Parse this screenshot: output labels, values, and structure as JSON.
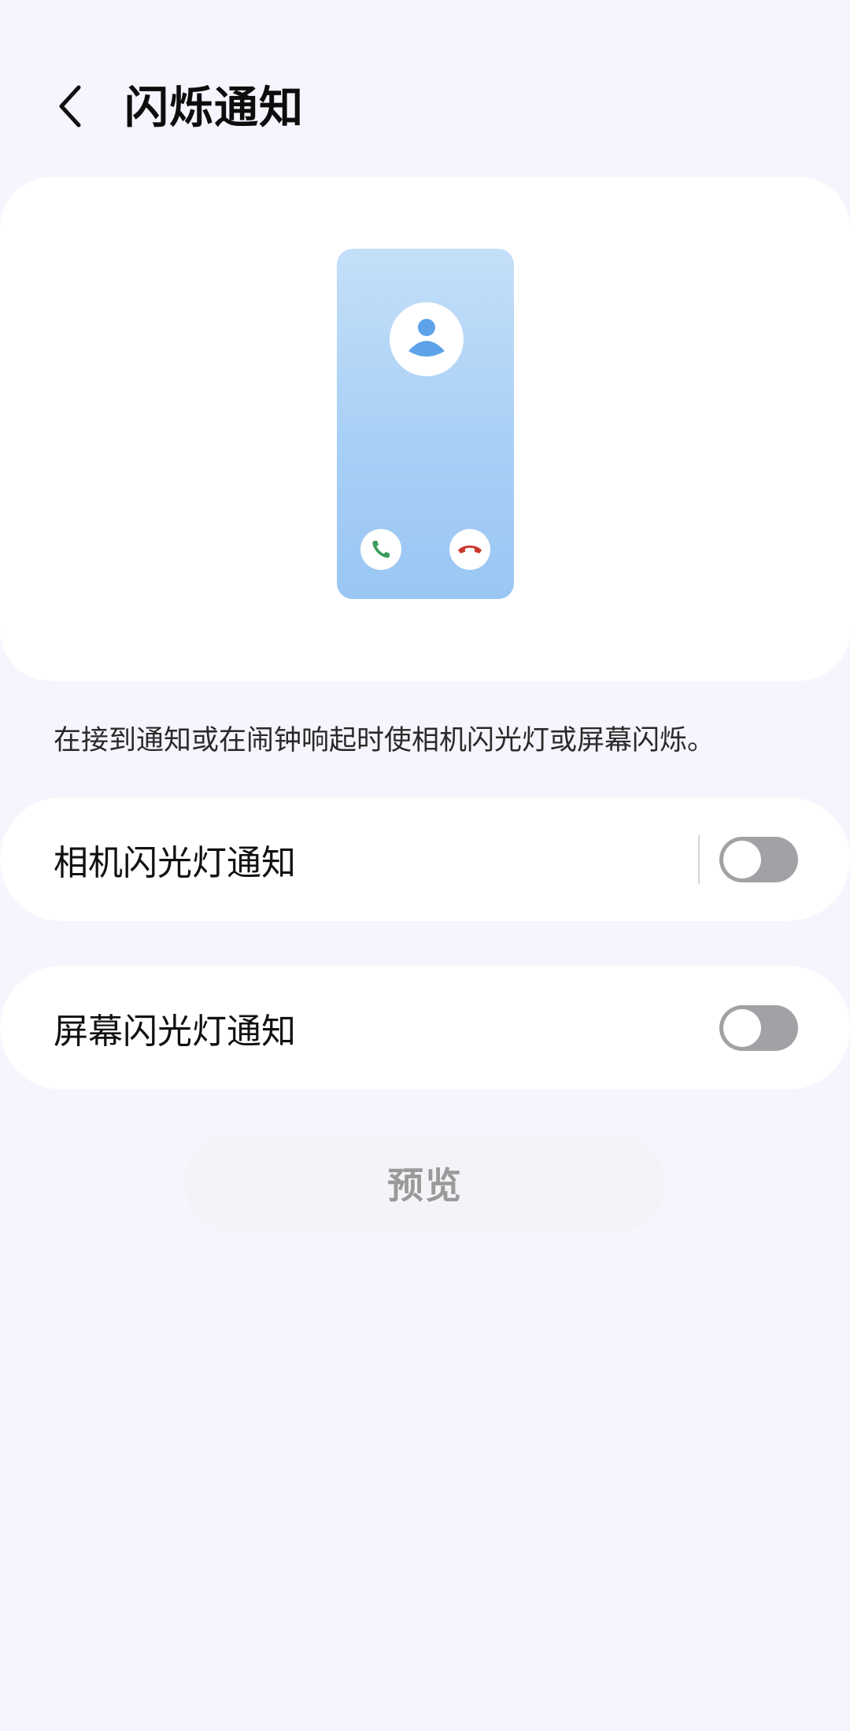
{
  "header": {
    "title": "闪烁通知",
    "back_icon": "chevron-left-icon"
  },
  "illustration": {
    "avatar_icon": "person-icon",
    "accept_icon": "phone-icon",
    "decline_icon": "phone-hangup-icon",
    "colors": {
      "accept": "#3a9b5c",
      "decline": "#c8372d",
      "avatar": "#5ea3ea"
    }
  },
  "description": "在接到通知或在闹钟响起时使相机闪光灯或屏幕闪烁。",
  "settings": [
    {
      "label": "相机闪光灯通知",
      "enabled": false
    },
    {
      "label": "屏幕闪光灯通知",
      "enabled": false
    }
  ],
  "preview_button": {
    "label": "预览",
    "enabled": false
  }
}
